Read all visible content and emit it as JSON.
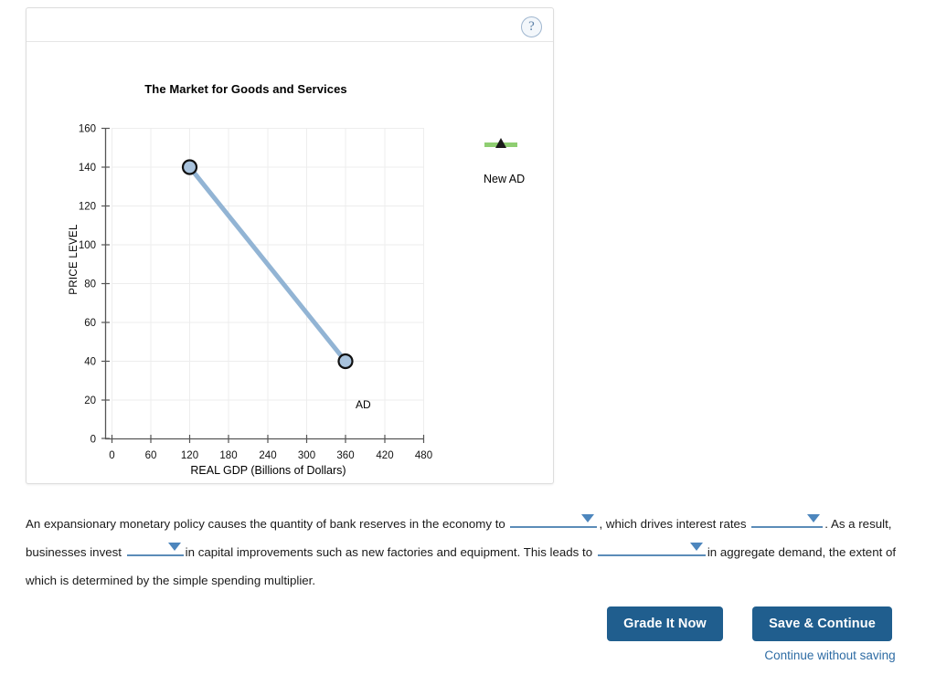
{
  "card": {
    "help_icon_label": "?"
  },
  "chart_data": {
    "type": "line",
    "title": "The Market for Goods and Services",
    "xlabel": "REAL GDP (Billions of Dollars)",
    "ylabel": "PRICE LEVEL",
    "xlim": [
      0,
      480
    ],
    "ylim": [
      0,
      160
    ],
    "xticks": [
      0,
      60,
      120,
      180,
      240,
      300,
      360,
      420,
      480
    ],
    "yticks": [
      0,
      20,
      40,
      60,
      80,
      100,
      120,
      140,
      160
    ],
    "grid": true,
    "legend_position": "right",
    "series": [
      {
        "name": "AD",
        "label": "AD",
        "color": "#92b4d4",
        "marker": "circle",
        "points": [
          {
            "x": 120,
            "y": 140
          },
          {
            "x": 360,
            "y": 40
          }
        ]
      },
      {
        "name": "New AD",
        "label": "New AD",
        "color": "#8fce72",
        "marker": "triangle",
        "points": []
      }
    ],
    "annotations": [
      {
        "text": "AD",
        "x": 360,
        "y": 40
      }
    ]
  },
  "question": {
    "part1": "An expansionary monetary policy causes the quantity of bank reserves in the economy to",
    "part2": ", which drives interest rates",
    "part3": ". As a result, businesses invest",
    "part4": "in capital improvements such as new factories and equipment. This leads to",
    "part5": "in aggregate demand, the extent of which is determined by the simple spending multiplier.",
    "dropdowns": [
      {
        "name": "bank-reserves-dropdown",
        "value": ""
      },
      {
        "name": "interest-rates-dropdown",
        "value": ""
      },
      {
        "name": "businesses-invest-dropdown",
        "value": ""
      },
      {
        "name": "aggregate-demand-dropdown",
        "value": ""
      }
    ]
  },
  "actions": {
    "grade_label": "Grade It Now",
    "save_label": "Save & Continue",
    "continue_without_saving_label": "Continue without saving"
  },
  "colors": {
    "accent": "#205e8e",
    "link": "#2e6ca4",
    "ad_line": "#92b4d4",
    "new_ad_line": "#8fce72",
    "dropdown": "#4d86bd"
  }
}
